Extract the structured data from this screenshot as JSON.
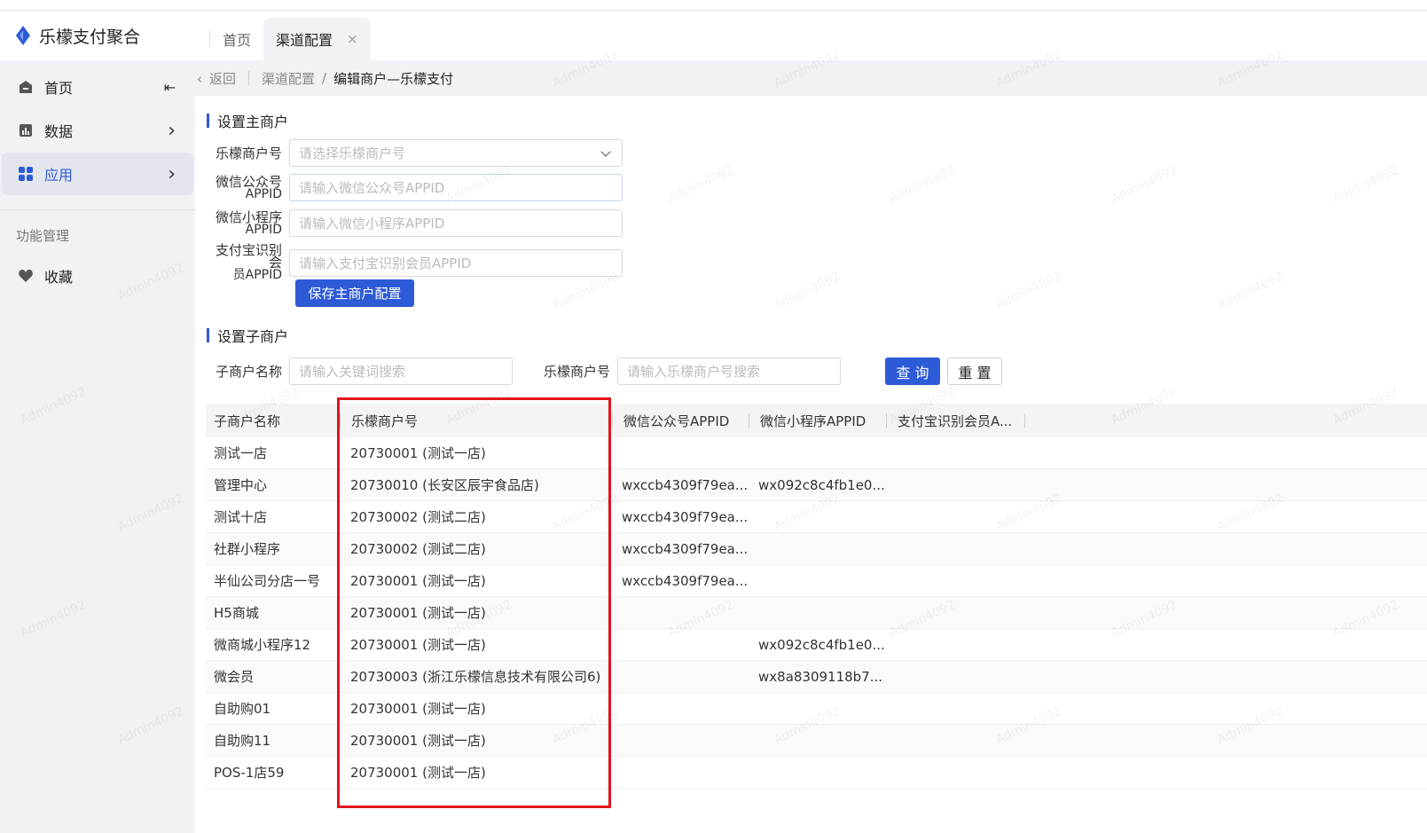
{
  "app": {
    "title": "乐檬支付聚合"
  },
  "tabs": [
    {
      "label": "首页"
    },
    {
      "label": "渠道配置",
      "close": "×"
    }
  ],
  "sidebar": {
    "items": [
      {
        "label": "首页",
        "icon": "home-icon",
        "toggle": "⇤"
      },
      {
        "label": "数据",
        "icon": "chart-icon",
        "arrow": "›"
      },
      {
        "label": "应用",
        "icon": "apps-icon",
        "arrow": "›"
      }
    ],
    "section": "功能管理",
    "favorites": {
      "label": "收藏",
      "icon": "heart-icon"
    }
  },
  "breadcrumb": {
    "back": "返回",
    "parent": "渠道配置",
    "sep": "/",
    "current": "编辑商户—乐檬支付"
  },
  "main_merchant": {
    "title": "设置主商户",
    "merchant_label": "乐檬商户号",
    "merchant_placeholder": "请选择乐檬商户号",
    "wx_pub_label": "微信公众号",
    "wx_pub_label2": "APPID",
    "wx_pub_placeholder": "请输入微信公众号APPID",
    "wx_mini_label": "微信小程序",
    "wx_mini_label2": "APPID",
    "wx_mini_placeholder": "请输入微信小程序APPID",
    "alipay_label": "支付宝识别会",
    "alipay_label2": "员APPID",
    "alipay_placeholder": "请输入支付宝识别会员APPID",
    "save_button": "保存主商户配置"
  },
  "sub_merchant": {
    "title": "设置子商户",
    "name_label": "子商户名称",
    "name_placeholder": "请输入关键词搜索",
    "merchant_label": "乐檬商户号",
    "merchant_placeholder": "请输入乐檬商户号搜索",
    "query_button": "查 询",
    "reset_button": "重 置"
  },
  "table": {
    "headers": [
      "子商户名称",
      "乐檬商户号",
      "微信公众号APPID",
      "微信小程序APPID",
      "支付宝识别会员A..."
    ],
    "rows": [
      [
        "测试一店",
        "20730001 (测试一店)",
        "",
        ""
      ],
      [
        "管理中心",
        "20730010 (长安区辰宇食品店)",
        "wxccb4309f79ea...",
        "wx092c8c4fb1e0..."
      ],
      [
        "测试十店",
        "20730002 (测试二店)",
        "wxccb4309f79ea...",
        ""
      ],
      [
        "社群小程序",
        "20730002 (测试二店)",
        "wxccb4309f79ea...",
        ""
      ],
      [
        "半仙公司分店一号",
        "20730001 (测试一店)",
        "wxccb4309f79ea...",
        ""
      ],
      [
        "H5商城",
        "20730001 (测试一店)",
        "",
        ""
      ],
      [
        "微商城小程序12",
        "20730001 (测试一店)",
        "",
        "wx092c8c4fb1e0..."
      ],
      [
        "微会员",
        "20730003 (浙江乐檬信息技术有限公司6)",
        "",
        "wx8a8309118b7..."
      ],
      [
        "自助购01",
        "20730001 (测试一店)",
        "",
        ""
      ],
      [
        "自助购11",
        "20730001 (测试一店)",
        "",
        ""
      ],
      [
        "POS-1店59",
        "20730001 (测试一店)",
        "",
        ""
      ]
    ]
  },
  "watermark": "Admin4092",
  "colors": {
    "accent": "#2d5ad6",
    "highlight": "#e3141d"
  }
}
